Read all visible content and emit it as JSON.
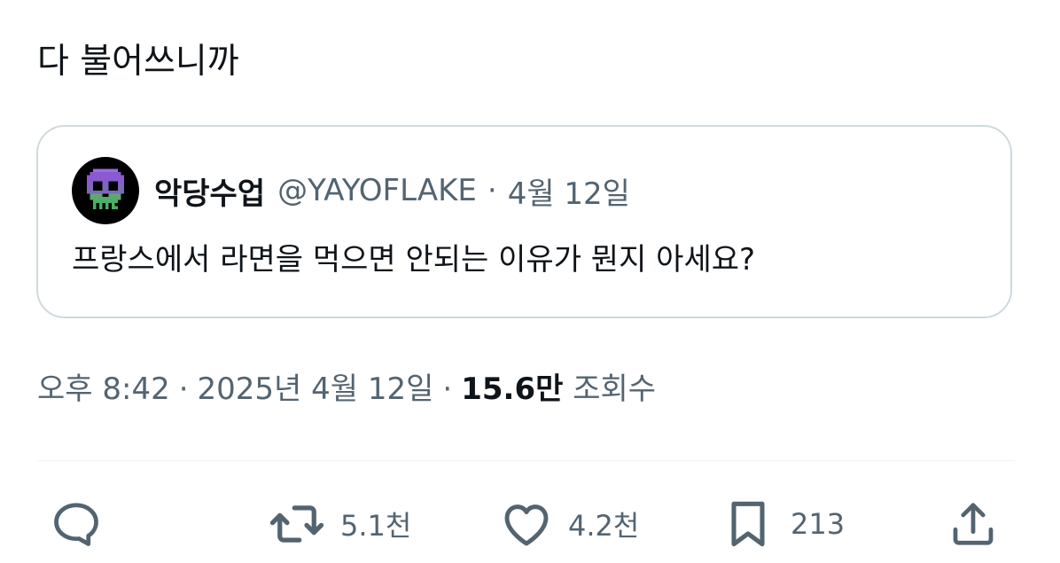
{
  "tweet": {
    "text": "다 불어쓰니까"
  },
  "quote": {
    "author_name": "악당수업",
    "author_handle": "@YAYOFLAKE",
    "separator": "·",
    "date": "4월 12일",
    "text": "프랑스에서 라면을 먹으면 안되는 이유가 뭔지 아세요?",
    "avatar_icon": "skull-icon"
  },
  "meta": {
    "time": "오후 8:42",
    "date": "2025년 4월 12일",
    "separator": "·",
    "views_count": "15.6만",
    "views_label": "조회수"
  },
  "actions": {
    "reply": {
      "icon": "reply-icon",
      "count": ""
    },
    "retweet": {
      "icon": "retweet-icon",
      "count": "5.1천"
    },
    "like": {
      "icon": "heart-icon",
      "count": "4.2천"
    },
    "bookmark": {
      "icon": "bookmark-icon",
      "count": "213"
    },
    "share": {
      "icon": "share-icon",
      "count": ""
    }
  },
  "colors": {
    "text_primary": "#0f1419",
    "text_secondary": "#536471",
    "border": "#cfd9de",
    "skull_purple": "#8a5ad0",
    "skull_green": "#4caf63"
  }
}
